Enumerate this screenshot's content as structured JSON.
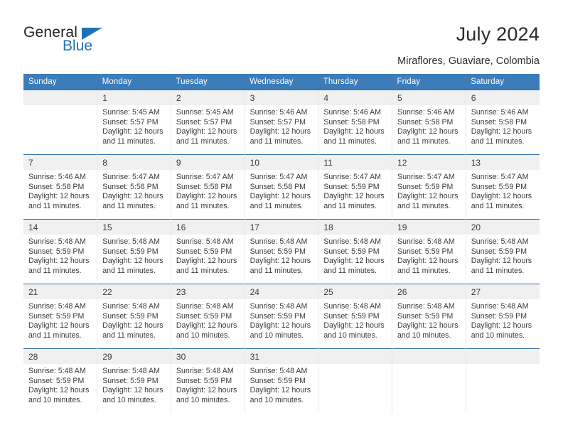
{
  "brand": {
    "name_top": "General",
    "name_bottom": "Blue"
  },
  "header": {
    "title": "July 2024",
    "subtitle": "Miraflores, Guaviare, Colombia"
  },
  "colors": {
    "header_blue": "#3c7cb8",
    "row_divider_blue": "#2f6da8",
    "daynum_band": "#f0f0f0",
    "brand_blue": "#1f72b8",
    "text": "#3a3a3a"
  },
  "calendar": {
    "weekday_headers": [
      "Sunday",
      "Monday",
      "Tuesday",
      "Wednesday",
      "Thursday",
      "Friday",
      "Saturday"
    ],
    "weeks": [
      [
        {
          "day": "",
          "lines": []
        },
        {
          "day": "1",
          "lines": [
            "Sunrise: 5:45 AM",
            "Sunset: 5:57 PM",
            "Daylight: 12 hours",
            "and 11 minutes."
          ]
        },
        {
          "day": "2",
          "lines": [
            "Sunrise: 5:45 AM",
            "Sunset: 5:57 PM",
            "Daylight: 12 hours",
            "and 11 minutes."
          ]
        },
        {
          "day": "3",
          "lines": [
            "Sunrise: 5:46 AM",
            "Sunset: 5:57 PM",
            "Daylight: 12 hours",
            "and 11 minutes."
          ]
        },
        {
          "day": "4",
          "lines": [
            "Sunrise: 5:46 AM",
            "Sunset: 5:58 PM",
            "Daylight: 12 hours",
            "and 11 minutes."
          ]
        },
        {
          "day": "5",
          "lines": [
            "Sunrise: 5:46 AM",
            "Sunset: 5:58 PM",
            "Daylight: 12 hours",
            "and 11 minutes."
          ]
        },
        {
          "day": "6",
          "lines": [
            "Sunrise: 5:46 AM",
            "Sunset: 5:58 PM",
            "Daylight: 12 hours",
            "and 11 minutes."
          ]
        }
      ],
      [
        {
          "day": "7",
          "lines": [
            "Sunrise: 5:46 AM",
            "Sunset: 5:58 PM",
            "Daylight: 12 hours",
            "and 11 minutes."
          ]
        },
        {
          "day": "8",
          "lines": [
            "Sunrise: 5:47 AM",
            "Sunset: 5:58 PM",
            "Daylight: 12 hours",
            "and 11 minutes."
          ]
        },
        {
          "day": "9",
          "lines": [
            "Sunrise: 5:47 AM",
            "Sunset: 5:58 PM",
            "Daylight: 12 hours",
            "and 11 minutes."
          ]
        },
        {
          "day": "10",
          "lines": [
            "Sunrise: 5:47 AM",
            "Sunset: 5:58 PM",
            "Daylight: 12 hours",
            "and 11 minutes."
          ]
        },
        {
          "day": "11",
          "lines": [
            "Sunrise: 5:47 AM",
            "Sunset: 5:59 PM",
            "Daylight: 12 hours",
            "and 11 minutes."
          ]
        },
        {
          "day": "12",
          "lines": [
            "Sunrise: 5:47 AM",
            "Sunset: 5:59 PM",
            "Daylight: 12 hours",
            "and 11 minutes."
          ]
        },
        {
          "day": "13",
          "lines": [
            "Sunrise: 5:47 AM",
            "Sunset: 5:59 PM",
            "Daylight: 12 hours",
            "and 11 minutes."
          ]
        }
      ],
      [
        {
          "day": "14",
          "lines": [
            "Sunrise: 5:48 AM",
            "Sunset: 5:59 PM",
            "Daylight: 12 hours",
            "and 11 minutes."
          ]
        },
        {
          "day": "15",
          "lines": [
            "Sunrise: 5:48 AM",
            "Sunset: 5:59 PM",
            "Daylight: 12 hours",
            "and 11 minutes."
          ]
        },
        {
          "day": "16",
          "lines": [
            "Sunrise: 5:48 AM",
            "Sunset: 5:59 PM",
            "Daylight: 12 hours",
            "and 11 minutes."
          ]
        },
        {
          "day": "17",
          "lines": [
            "Sunrise: 5:48 AM",
            "Sunset: 5:59 PM",
            "Daylight: 12 hours",
            "and 11 minutes."
          ]
        },
        {
          "day": "18",
          "lines": [
            "Sunrise: 5:48 AM",
            "Sunset: 5:59 PM",
            "Daylight: 12 hours",
            "and 11 minutes."
          ]
        },
        {
          "day": "19",
          "lines": [
            "Sunrise: 5:48 AM",
            "Sunset: 5:59 PM",
            "Daylight: 12 hours",
            "and 11 minutes."
          ]
        },
        {
          "day": "20",
          "lines": [
            "Sunrise: 5:48 AM",
            "Sunset: 5:59 PM",
            "Daylight: 12 hours",
            "and 11 minutes."
          ]
        }
      ],
      [
        {
          "day": "21",
          "lines": [
            "Sunrise: 5:48 AM",
            "Sunset: 5:59 PM",
            "Daylight: 12 hours",
            "and 11 minutes."
          ]
        },
        {
          "day": "22",
          "lines": [
            "Sunrise: 5:48 AM",
            "Sunset: 5:59 PM",
            "Daylight: 12 hours",
            "and 11 minutes."
          ]
        },
        {
          "day": "23",
          "lines": [
            "Sunrise: 5:48 AM",
            "Sunset: 5:59 PM",
            "Daylight: 12 hours",
            "and 10 minutes."
          ]
        },
        {
          "day": "24",
          "lines": [
            "Sunrise: 5:48 AM",
            "Sunset: 5:59 PM",
            "Daylight: 12 hours",
            "and 10 minutes."
          ]
        },
        {
          "day": "25",
          "lines": [
            "Sunrise: 5:48 AM",
            "Sunset: 5:59 PM",
            "Daylight: 12 hours",
            "and 10 minutes."
          ]
        },
        {
          "day": "26",
          "lines": [
            "Sunrise: 5:48 AM",
            "Sunset: 5:59 PM",
            "Daylight: 12 hours",
            "and 10 minutes."
          ]
        },
        {
          "day": "27",
          "lines": [
            "Sunrise: 5:48 AM",
            "Sunset: 5:59 PM",
            "Daylight: 12 hours",
            "and 10 minutes."
          ]
        }
      ],
      [
        {
          "day": "28",
          "lines": [
            "Sunrise: 5:48 AM",
            "Sunset: 5:59 PM",
            "Daylight: 12 hours",
            "and 10 minutes."
          ]
        },
        {
          "day": "29",
          "lines": [
            "Sunrise: 5:48 AM",
            "Sunset: 5:59 PM",
            "Daylight: 12 hours",
            "and 10 minutes."
          ]
        },
        {
          "day": "30",
          "lines": [
            "Sunrise: 5:48 AM",
            "Sunset: 5:59 PM",
            "Daylight: 12 hours",
            "and 10 minutes."
          ]
        },
        {
          "day": "31",
          "lines": [
            "Sunrise: 5:48 AM",
            "Sunset: 5:59 PM",
            "Daylight: 12 hours",
            "and 10 minutes."
          ]
        },
        {
          "day": "",
          "lines": []
        },
        {
          "day": "",
          "lines": []
        },
        {
          "day": "",
          "lines": []
        }
      ]
    ]
  }
}
